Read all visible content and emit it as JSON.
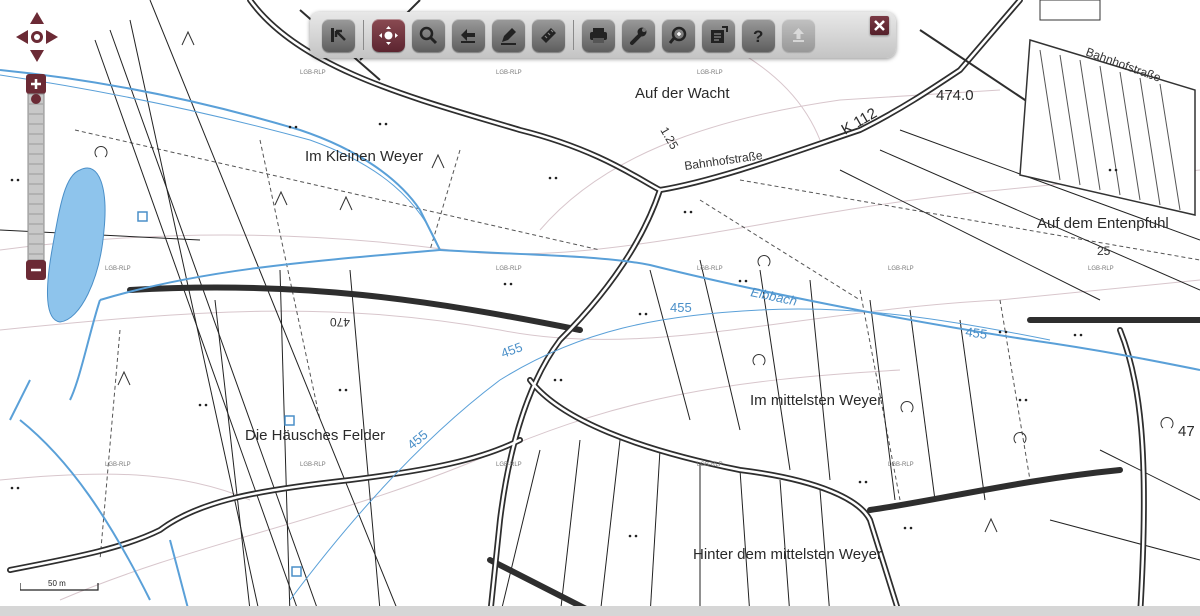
{
  "map": {
    "field_names": [
      {
        "text": "Auf der Wacht",
        "name": "label-auf-der-wacht"
      },
      {
        "text": "Im Kleinen Weyer",
        "name": "label-im-kleinen-weyer"
      },
      {
        "text": "Auf dem Entenpfuhl",
        "name": "label-auf-dem-entenpfuhl"
      },
      {
        "text": "Im mittelsten Weyer",
        "name": "label-im-mittelsten-weyer"
      },
      {
        "text": "Die Häusches Felder",
        "name": "label-die-hauesches-felder"
      },
      {
        "text": "Hinter dem mittelsten Weyer",
        "name": "label-hinter-dem-mittelsten-weyer"
      }
    ],
    "streets": {
      "bahnhofstrasse": "Bahnhofstraße",
      "k112": "K 112"
    },
    "stream": "Elbbach",
    "elevations": {
      "e474": "474.0",
      "e47": "47",
      "c455": "455",
      "c25": "25",
      "c470": "470",
      "c125": "1.25"
    },
    "watermark": "LGB-RLP",
    "scale_label": "50 m"
  },
  "toolbar": {
    "buttons": [
      {
        "name": "info-tool-button",
        "icon": "info-arrow-icon"
      },
      {
        "name": "pan-tool-button",
        "icon": "pan-move-icon",
        "active": true
      },
      {
        "name": "zoom-tool-button",
        "icon": "magnifier-icon"
      },
      {
        "name": "back-button",
        "icon": "arrow-back-icon"
      },
      {
        "name": "draw-tool-button",
        "icon": "pencil-icon"
      },
      {
        "name": "measure-tool-button",
        "icon": "ruler-icon"
      },
      {
        "name": "print-button",
        "icon": "printer-icon"
      },
      {
        "name": "settings-button",
        "icon": "wrench-icon"
      },
      {
        "name": "search-button",
        "icon": "search-plus-icon"
      },
      {
        "name": "export-button",
        "icon": "document-icon"
      },
      {
        "name": "help-button",
        "icon": "question-icon"
      },
      {
        "name": "upload-button",
        "icon": "upload-icon",
        "disabled": true
      }
    ],
    "close": "close-icon"
  },
  "colors": {
    "road": "#2e2e2e",
    "water": "#5aa0d8",
    "lake": "#8ec4ec",
    "accent": "#6b2a35"
  }
}
